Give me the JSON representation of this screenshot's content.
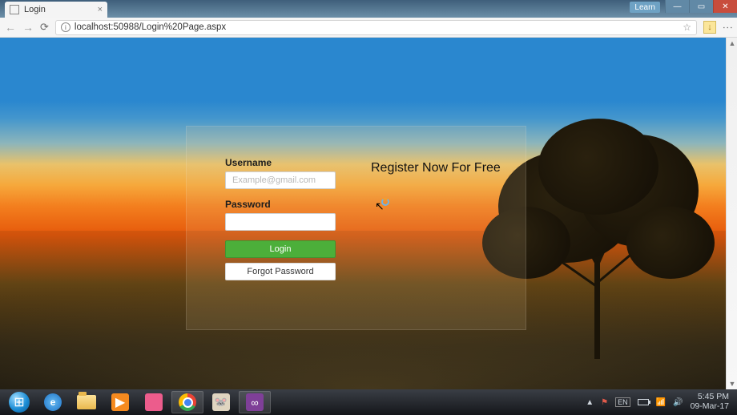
{
  "browser": {
    "tab_title": "Login",
    "url": "localhost:50988/Login%20Page.aspx",
    "learn_label": "Learn"
  },
  "login": {
    "username_label": "Username",
    "username_placeholder": "Example@gmail.com",
    "username_value": "",
    "password_label": "Password",
    "password_value": "",
    "login_button": "Login",
    "forgot_button": "Forgot Password",
    "register_heading": "Register Now For Free"
  },
  "taskbar": {
    "time": "5:45 PM",
    "date": "09-Mar-17",
    "lang": "EN"
  }
}
